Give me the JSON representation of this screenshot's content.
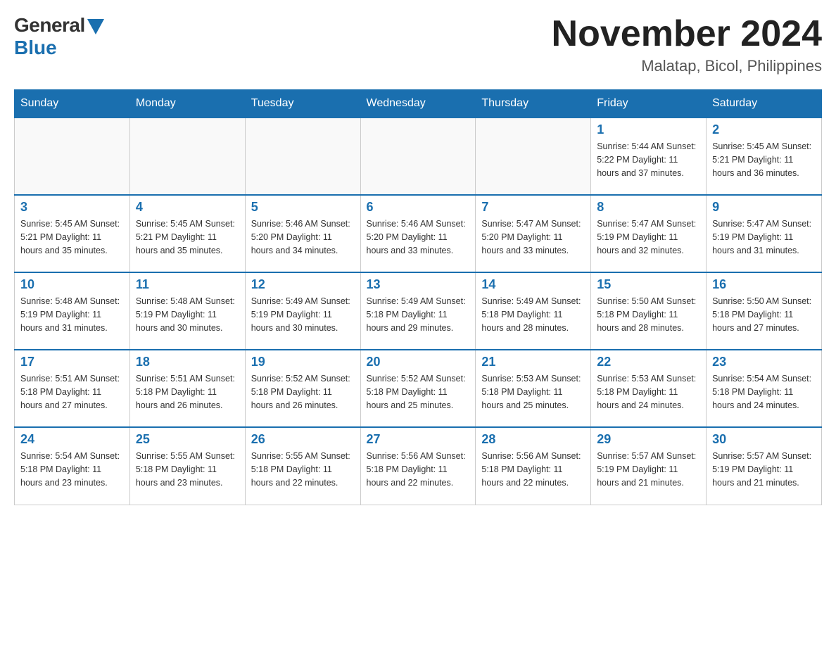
{
  "logo": {
    "general": "General",
    "blue": "Blue"
  },
  "title": {
    "month_year": "November 2024",
    "location": "Malatap, Bicol, Philippines"
  },
  "weekdays": [
    "Sunday",
    "Monday",
    "Tuesday",
    "Wednesday",
    "Thursday",
    "Friday",
    "Saturday"
  ],
  "weeks": [
    [
      {
        "day": "",
        "info": ""
      },
      {
        "day": "",
        "info": ""
      },
      {
        "day": "",
        "info": ""
      },
      {
        "day": "",
        "info": ""
      },
      {
        "day": "",
        "info": ""
      },
      {
        "day": "1",
        "info": "Sunrise: 5:44 AM\nSunset: 5:22 PM\nDaylight: 11 hours and 37 minutes."
      },
      {
        "day": "2",
        "info": "Sunrise: 5:45 AM\nSunset: 5:21 PM\nDaylight: 11 hours and 36 minutes."
      }
    ],
    [
      {
        "day": "3",
        "info": "Sunrise: 5:45 AM\nSunset: 5:21 PM\nDaylight: 11 hours and 35 minutes."
      },
      {
        "day": "4",
        "info": "Sunrise: 5:45 AM\nSunset: 5:21 PM\nDaylight: 11 hours and 35 minutes."
      },
      {
        "day": "5",
        "info": "Sunrise: 5:46 AM\nSunset: 5:20 PM\nDaylight: 11 hours and 34 minutes."
      },
      {
        "day": "6",
        "info": "Sunrise: 5:46 AM\nSunset: 5:20 PM\nDaylight: 11 hours and 33 minutes."
      },
      {
        "day": "7",
        "info": "Sunrise: 5:47 AM\nSunset: 5:20 PM\nDaylight: 11 hours and 33 minutes."
      },
      {
        "day": "8",
        "info": "Sunrise: 5:47 AM\nSunset: 5:19 PM\nDaylight: 11 hours and 32 minutes."
      },
      {
        "day": "9",
        "info": "Sunrise: 5:47 AM\nSunset: 5:19 PM\nDaylight: 11 hours and 31 minutes."
      }
    ],
    [
      {
        "day": "10",
        "info": "Sunrise: 5:48 AM\nSunset: 5:19 PM\nDaylight: 11 hours and 31 minutes."
      },
      {
        "day": "11",
        "info": "Sunrise: 5:48 AM\nSunset: 5:19 PM\nDaylight: 11 hours and 30 minutes."
      },
      {
        "day": "12",
        "info": "Sunrise: 5:49 AM\nSunset: 5:19 PM\nDaylight: 11 hours and 30 minutes."
      },
      {
        "day": "13",
        "info": "Sunrise: 5:49 AM\nSunset: 5:18 PM\nDaylight: 11 hours and 29 minutes."
      },
      {
        "day": "14",
        "info": "Sunrise: 5:49 AM\nSunset: 5:18 PM\nDaylight: 11 hours and 28 minutes."
      },
      {
        "day": "15",
        "info": "Sunrise: 5:50 AM\nSunset: 5:18 PM\nDaylight: 11 hours and 28 minutes."
      },
      {
        "day": "16",
        "info": "Sunrise: 5:50 AM\nSunset: 5:18 PM\nDaylight: 11 hours and 27 minutes."
      }
    ],
    [
      {
        "day": "17",
        "info": "Sunrise: 5:51 AM\nSunset: 5:18 PM\nDaylight: 11 hours and 27 minutes."
      },
      {
        "day": "18",
        "info": "Sunrise: 5:51 AM\nSunset: 5:18 PM\nDaylight: 11 hours and 26 minutes."
      },
      {
        "day": "19",
        "info": "Sunrise: 5:52 AM\nSunset: 5:18 PM\nDaylight: 11 hours and 26 minutes."
      },
      {
        "day": "20",
        "info": "Sunrise: 5:52 AM\nSunset: 5:18 PM\nDaylight: 11 hours and 25 minutes."
      },
      {
        "day": "21",
        "info": "Sunrise: 5:53 AM\nSunset: 5:18 PM\nDaylight: 11 hours and 25 minutes."
      },
      {
        "day": "22",
        "info": "Sunrise: 5:53 AM\nSunset: 5:18 PM\nDaylight: 11 hours and 24 minutes."
      },
      {
        "day": "23",
        "info": "Sunrise: 5:54 AM\nSunset: 5:18 PM\nDaylight: 11 hours and 24 minutes."
      }
    ],
    [
      {
        "day": "24",
        "info": "Sunrise: 5:54 AM\nSunset: 5:18 PM\nDaylight: 11 hours and 23 minutes."
      },
      {
        "day": "25",
        "info": "Sunrise: 5:55 AM\nSunset: 5:18 PM\nDaylight: 11 hours and 23 minutes."
      },
      {
        "day": "26",
        "info": "Sunrise: 5:55 AM\nSunset: 5:18 PM\nDaylight: 11 hours and 22 minutes."
      },
      {
        "day": "27",
        "info": "Sunrise: 5:56 AM\nSunset: 5:18 PM\nDaylight: 11 hours and 22 minutes."
      },
      {
        "day": "28",
        "info": "Sunrise: 5:56 AM\nSunset: 5:18 PM\nDaylight: 11 hours and 22 minutes."
      },
      {
        "day": "29",
        "info": "Sunrise: 5:57 AM\nSunset: 5:19 PM\nDaylight: 11 hours and 21 minutes."
      },
      {
        "day": "30",
        "info": "Sunrise: 5:57 AM\nSunset: 5:19 PM\nDaylight: 11 hours and 21 minutes."
      }
    ]
  ]
}
